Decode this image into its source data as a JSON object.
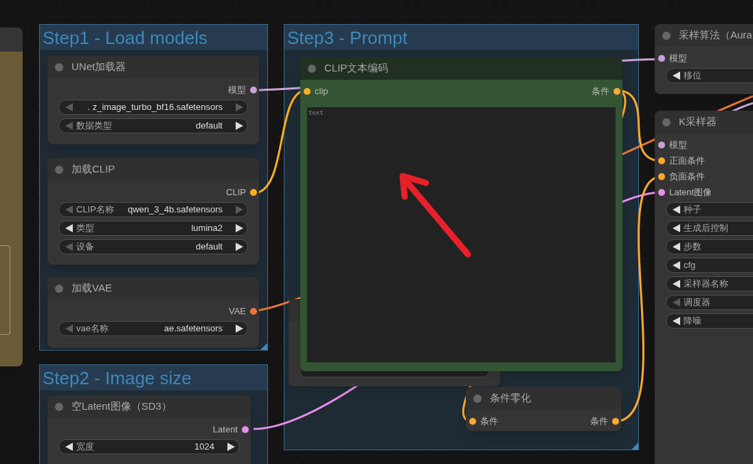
{
  "groups": [
    {
      "title": "Step1 - Load models"
    },
    {
      "title": "Step2 - Image size"
    },
    {
      "title": "Step3 - Prompt"
    }
  ],
  "nodes": [
    {
      "kind": "preview"
    },
    {
      "kind": "standard",
      "title": "UNet加载器",
      "outputs": [
        {
          "label": "模型",
          "color": "#c8a2d8"
        }
      ],
      "widgets": [
        {
          "value": ". z_image_turbo_bf16.safetensors",
          "prev_disabled": true,
          "next_disabled": true
        },
        {
          "label": "数据类型",
          "value": "default",
          "prev_disabled": true,
          "next_disabled": false
        }
      ]
    },
    {
      "kind": "standard",
      "title": "加载CLIP",
      "outputs": [
        {
          "label": "CLIP",
          "color": "#ffb020"
        }
      ],
      "widgets": [
        {
          "label": "CLIP名称",
          "value": "qwen_3_4b.safetensors",
          "prev_disabled": true,
          "next_disabled": true
        },
        {
          "label": "类型",
          "value": "lumina2",
          "prev_disabled": false,
          "next_disabled": false
        },
        {
          "label": "设备",
          "value": "default",
          "prev_disabled": true,
          "next_disabled": false
        }
      ]
    },
    {
      "kind": "standard",
      "title": "加载VAE",
      "outputs": [
        {
          "label": "VAE",
          "color": "#e8763a"
        }
      ],
      "widgets": [
        {
          "label": "vae名称",
          "value": "ae.safetensors",
          "prev_disabled": true,
          "next_disabled": false
        }
      ]
    },
    {
      "kind": "standard",
      "title": "空Latent图像（SD3）",
      "outputs": [
        {
          "label": "Latent",
          "color": "#e88ee8"
        }
      ],
      "widgets": [
        {
          "label": "宽度",
          "value": "1024",
          "prev_disabled": false,
          "next_disabled": false
        }
      ]
    },
    {
      "kind": "covered"
    },
    {
      "kind": "text_encoder",
      "title": "CLIP文本编码",
      "inputs": [
        {
          "label": "clip",
          "color": "#ffb020"
        }
      ],
      "outputs": [
        {
          "label": "条件",
          "color": "#ffa931"
        }
      ],
      "placeholder": "text"
    },
    {
      "kind": "standard",
      "title": "条件零化",
      "inputs": [
        {
          "label": "条件",
          "color": "#ffa931"
        }
      ],
      "outputs": [
        {
          "label": "条件",
          "color": "#ffa931"
        }
      ]
    },
    {
      "kind": "standard",
      "title": "采样算法（Aura",
      "inputs": [
        {
          "label": "模型",
          "color": "#c8a2d8"
        }
      ],
      "widgets": [
        {
          "label": "移位",
          "prev_disabled": false
        }
      ]
    },
    {
      "kind": "standard",
      "title": "K采样器",
      "inputs": [
        {
          "label": "模型",
          "color": "#c8a2d8"
        },
        {
          "label": "正面条件",
          "color": "#ffa931"
        },
        {
          "label": "负面条件",
          "color": "#ffa931"
        },
        {
          "label": "Latent图像",
          "color": "#e88ee8"
        }
      ],
      "widgets": [
        {
          "label": "种子",
          "prev_disabled": false
        },
        {
          "label": "生成后控制",
          "prev_disabled": false
        },
        {
          "label": "步数",
          "prev_disabled": false
        },
        {
          "label": "cfg",
          "prev_disabled": false
        },
        {
          "label": "采样器名称",
          "prev_disabled": false
        },
        {
          "label": "调度器",
          "prev_disabled": true
        },
        {
          "label": "降噪",
          "prev_disabled": false
        }
      ]
    }
  ]
}
